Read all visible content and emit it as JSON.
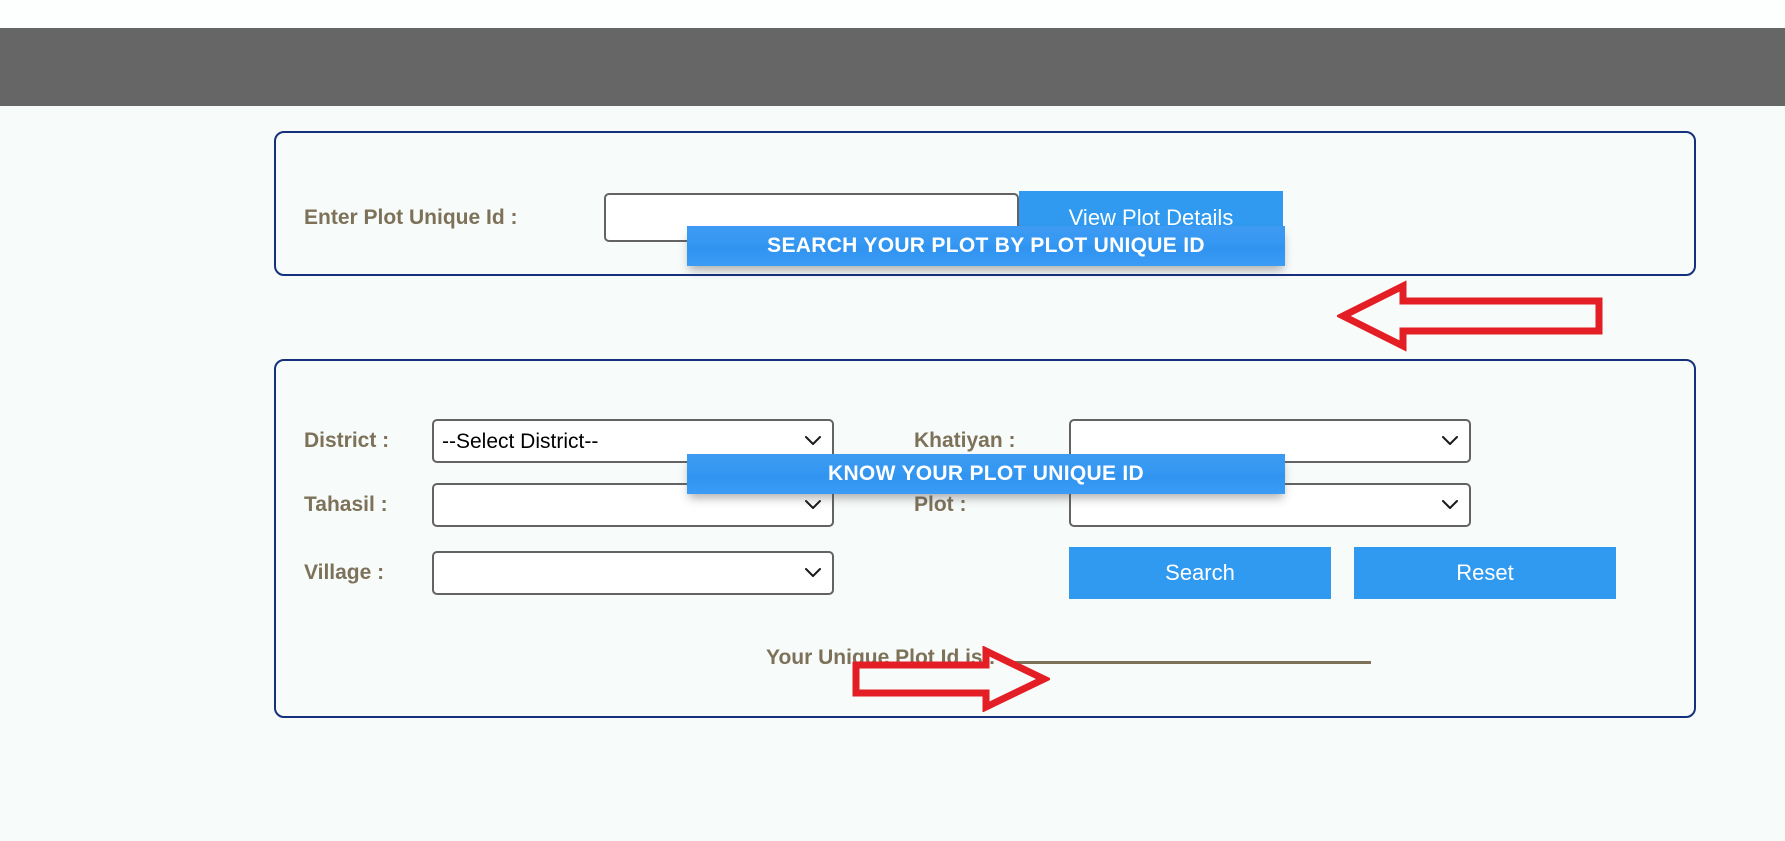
{
  "page": {
    "background_color": "#f7fbfa",
    "navbar_color": "#666666",
    "accent_blue": "#2f9af0",
    "panel_border_color": "#15317e",
    "label_color": "#7d7259",
    "annotation_color": "#e31e24"
  },
  "panel_search": {
    "banner_title": "SEARCH YOUR PLOT BY PLOT UNIQUE ID",
    "label": "Enter Plot Unique Id :",
    "input_value": "",
    "input_placeholder": "",
    "button_label": "View Plot Details"
  },
  "panel_know": {
    "banner_title": "KNOW YOUR PLOT UNIQUE ID",
    "fields": {
      "district": {
        "label": "District :",
        "selected": "--Select District--",
        "options": [
          "--Select District--"
        ]
      },
      "tahasil": {
        "label": "Tahasil :",
        "selected": "",
        "options": [
          ""
        ]
      },
      "village": {
        "label": "Village :",
        "selected": "",
        "options": [
          ""
        ]
      },
      "khatiyan": {
        "label": "Khatiyan :",
        "selected": "",
        "options": [
          ""
        ]
      },
      "plot": {
        "label": "Plot :",
        "selected": "",
        "options": [
          ""
        ]
      }
    },
    "search_button_label": "Search",
    "reset_button_label": "Reset",
    "result_label": "Your Unique Plot Id is :",
    "result_value": ""
  },
  "annotations": {
    "arrow_to_view_plot_details": "arrow-left-icon",
    "arrow_to_search": "arrow-right-icon"
  }
}
